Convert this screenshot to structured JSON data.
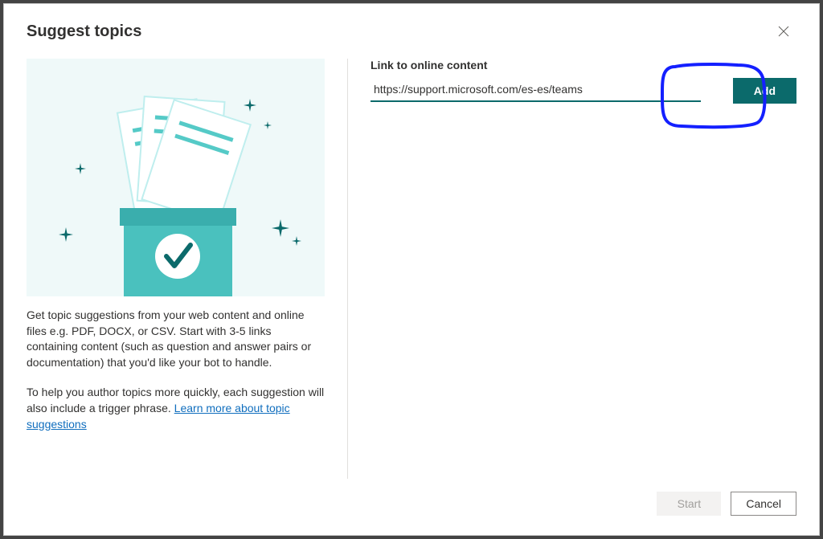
{
  "dialog": {
    "title": "Suggest topics"
  },
  "left": {
    "desc1": "Get topic suggestions from your web content and online files e.g. PDF, DOCX, or CSV. Start with 3-5 links containing content (such as question and answer pairs or documentation) that you'd like your bot to handle.",
    "desc2_a": "To help you author topics more quickly, each suggestion will also include a trigger phrase. ",
    "learn_link": "Learn more about topic suggestions"
  },
  "right": {
    "label": "Link to online content",
    "url_value": "https://support.microsoft.com/es-es/teams",
    "add_label": "Add"
  },
  "footer": {
    "start_label": "Start",
    "cancel_label": "Cancel"
  }
}
